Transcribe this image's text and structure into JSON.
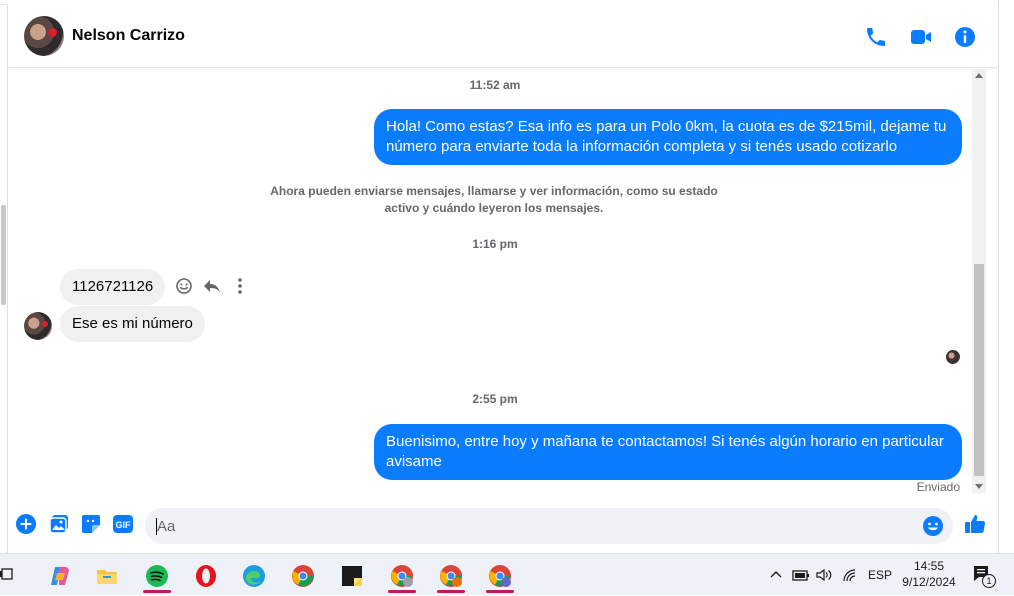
{
  "header": {
    "contact_name": "Nelson Carrizo"
  },
  "messages": {
    "time1": "11:52 am",
    "out1": "Hola! Como estas? Esa info es para un Polo 0km, la cuota es de $215mil, dejame tu número para enviarte toda la información completa y si tenés usado cotizarlo",
    "notice": "Ahora pueden enviarse mensajes, llamarse y ver información, como su estado activo y cuándo leyeron los mensajes.",
    "time2": "1:16 pm",
    "in1": "1126721126",
    "in2": "Ese es mi número",
    "time3": "2:55 pm",
    "out2": "Buenisimo, entre hoy y mañana te contactamos! Si tenés algún horario en particular avisame",
    "status": "Enviado"
  },
  "composer": {
    "placeholder": "Aa"
  },
  "taskbar": {
    "language": "ESP",
    "time": "14:55",
    "date": "9/12/2024",
    "notification_count": "1"
  },
  "colors": {
    "accent": "#0a7cff",
    "incoming_bubble": "#f0f0f0"
  }
}
